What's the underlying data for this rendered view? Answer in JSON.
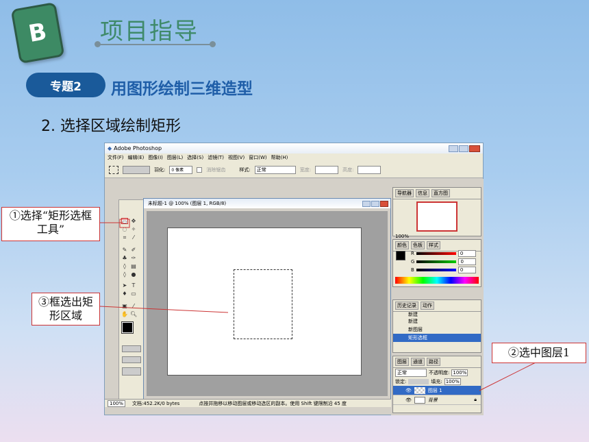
{
  "slide": {
    "badge": "B",
    "title": "项目指导",
    "topic_pill": "专题2",
    "topic_title": "用图形绘制三维造型",
    "step": "2. 选择区域绘制矩形"
  },
  "photoshop": {
    "app_title": "Adobe Photoshop",
    "menu": [
      "文件(F)",
      "编辑(E)",
      "图像(I)",
      "图层(L)",
      "选择(S)",
      "滤镜(T)",
      "视图(V)",
      "窗口(W)",
      "帮助(H)"
    ],
    "options": {
      "feather_label": "羽化:",
      "feather_value": "0 像素",
      "antialias_label": "消除锯齿",
      "style_label": "样式:",
      "style_value": "正常",
      "width_label": "宽度:",
      "height_label": "高度:"
    },
    "document": {
      "title": "未标题-1 @ 100% (图层 1, RGB/8)"
    },
    "status": {
      "zoom": "100%",
      "doc": "文档:452.2K/0 bytes",
      "hint": "点按并拖移以移动图层或移动选区的副本。使用 Shift 键限制沿 45 度"
    },
    "navigator": {
      "tabs": [
        "导航器",
        "信息",
        "直方图"
      ],
      "zoom": "100%"
    },
    "color": {
      "tabs": [
        "颜色",
        "色板",
        "样式"
      ],
      "channels": [
        {
          "name": "R",
          "value": "0"
        },
        {
          "name": "G",
          "value": "0"
        },
        {
          "name": "B",
          "value": "0"
        }
      ]
    },
    "history": {
      "tabs": [
        "历史记录",
        "动作"
      ],
      "items": [
        "新建",
        "新建",
        "新图层",
        "矩形选框"
      ]
    },
    "layers": {
      "tabs": [
        "图层",
        "通道",
        "路径"
      ],
      "blend": "正常",
      "opacity_label": "不透明度:",
      "opacity": "100%",
      "lock_label": "锁定:",
      "fill_label": "填充:",
      "fill": "100%",
      "items": [
        {
          "name": "图层 1",
          "selected": true
        },
        {
          "name": "背景",
          "selected": false
        }
      ]
    }
  },
  "callouts": {
    "c1": "①选择“矩形选框工具”",
    "c2": "②选中图层1",
    "c3": "③框选出矩形区域"
  },
  "colors": {
    "badge": "#3d8a64",
    "title": "#3f8a6a",
    "pill": "#1a5a9a",
    "topic": "#1f5ea8",
    "callout_border": "#cc3333"
  }
}
